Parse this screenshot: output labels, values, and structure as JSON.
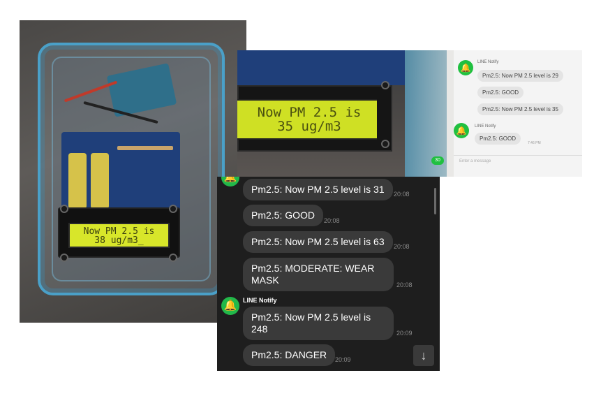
{
  "photo1": {
    "lcd_line1": "Now PM 2.5 is",
    "lcd_line2": "38 ug/m3_"
  },
  "photo2": {
    "lcd_line1": "Now PM 2.5 is",
    "lcd_line2": "35 ug/m3",
    "chat": {
      "sender": "LINE Notify",
      "messages": [
        {
          "text": "Pm2.5: Now PM 2.5 level is 29"
        },
        {
          "text": "Pm2.5: GOOD"
        },
        {
          "text": "Pm2.5: Now PM 2.5 level is 35"
        }
      ],
      "sender2": "LINE Notify",
      "messages2": [
        {
          "text": "Pm2.5: GOOD",
          "time": "7:46 PM"
        }
      ],
      "input_placeholder": "Enter a message",
      "badge": "30"
    }
  },
  "photo3": {
    "messages_top": [
      {
        "text": "Pm2.5: Now PM 2.5 level is 31",
        "time": "20:08"
      },
      {
        "text": "Pm2.5: GOOD",
        "time": "20:08"
      },
      {
        "text": "Pm2.5: Now PM 2.5 level is 63",
        "time": "20:08"
      },
      {
        "text": "Pm2.5: MODERATE: WEAR MASK",
        "time": "20:08"
      }
    ],
    "sender": "LINE Notify",
    "messages_bottom": [
      {
        "text": "Pm2.5: Now PM 2.5 level is 248",
        "time": "20:09"
      },
      {
        "text": "Pm2.5: DANGER",
        "time": "20:09"
      }
    ],
    "scroll_down_icon": "arrow-down-icon"
  },
  "colors": {
    "line_green": "#22b84a",
    "lcd_yellow": "#d8e62a",
    "dark_bg": "#1e1e1e",
    "bubble_dark": "#3a3a3a"
  }
}
